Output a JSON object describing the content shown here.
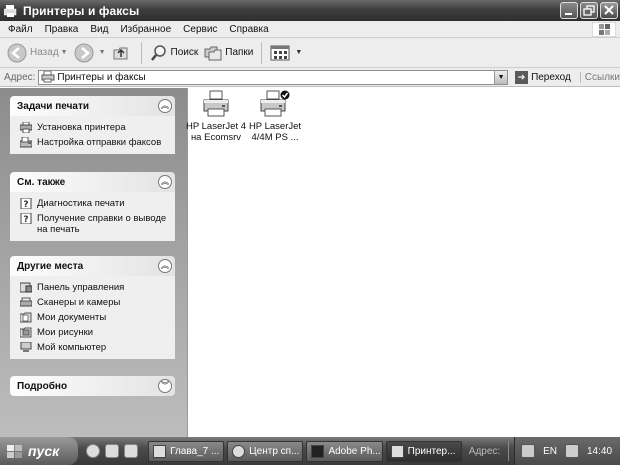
{
  "window": {
    "title": "Принтеры и факсы"
  },
  "menu": [
    "Файл",
    "Правка",
    "Вид",
    "Избранное",
    "Сервис",
    "Справка"
  ],
  "toolbar": {
    "back": "Назад",
    "search": "Поиск",
    "folders": "Папки"
  },
  "address": {
    "label": "Адрес:",
    "value": "Принтеры и факсы",
    "go": "Переход",
    "links": "Ссылки"
  },
  "panels": [
    {
      "title": "Задачи печати",
      "items": [
        "Установка принтера",
        "Настройка отправки факсов"
      ]
    },
    {
      "title": "См. также",
      "items": [
        "Диагностика печати",
        "Получение справки о выводе на печать"
      ]
    },
    {
      "title": "Другие места",
      "items": [
        "Панель управления",
        "Сканеры и камеры",
        "Мои документы",
        "Мои рисунки",
        "Мой компьютер"
      ]
    },
    {
      "title": "Подробно",
      "items": []
    }
  ],
  "printers": [
    {
      "line1": "HP LaserJet 4",
      "line2": "на Ecomsrv",
      "default": false
    },
    {
      "line1": "HP LaserJet",
      "line2": "4/4M PS ...",
      "default": true
    }
  ],
  "taskbar": {
    "start": "пуск",
    "tasks": [
      "Глава_7 ...",
      "Центр сп...",
      "Adobe Ph...",
      "Принтер..."
    ],
    "address": "Адрес:",
    "lang": "EN",
    "time": "14:40"
  }
}
